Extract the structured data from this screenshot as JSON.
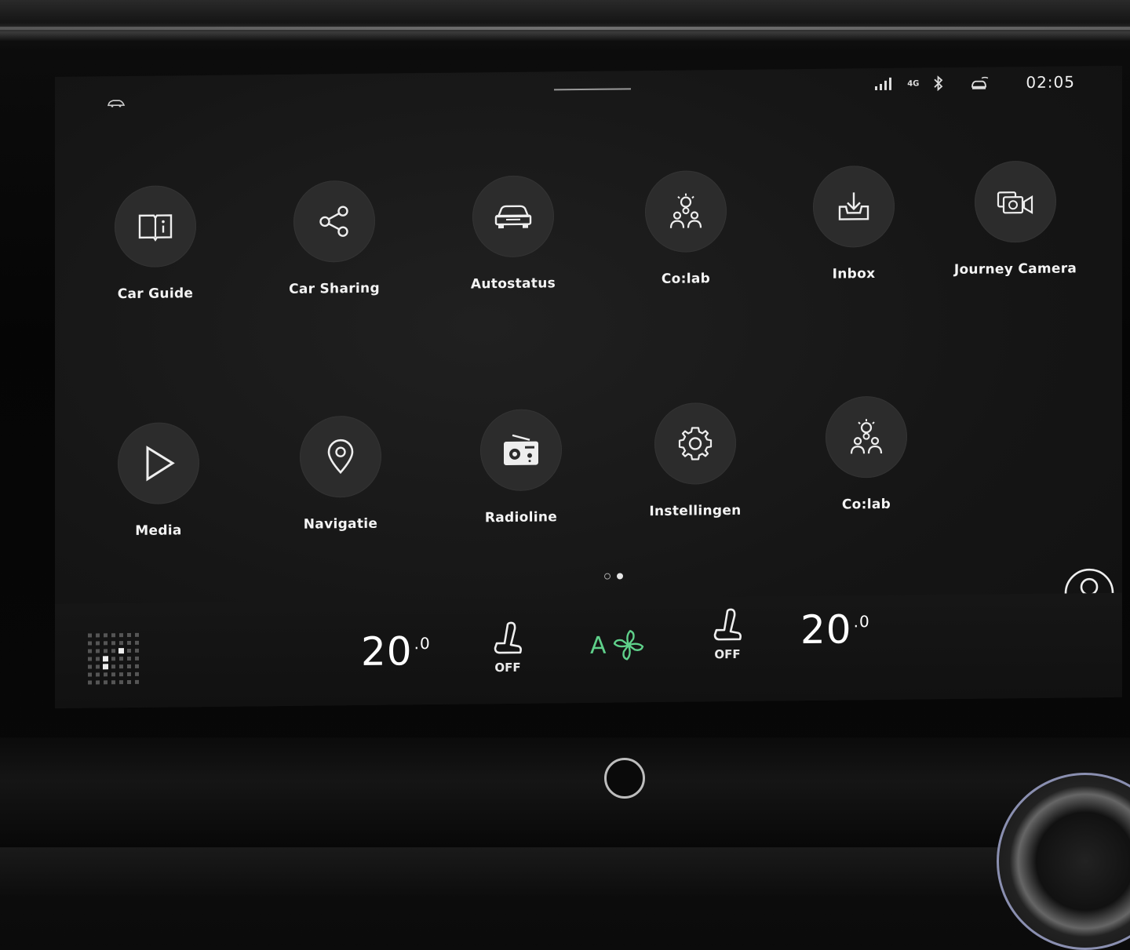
{
  "status": {
    "network": "4G",
    "time": "02:05"
  },
  "apps": [
    {
      "label": "Car Guide",
      "icon": "book-icon"
    },
    {
      "label": "Car Sharing",
      "icon": "share-icon"
    },
    {
      "label": "Autostatus",
      "icon": "car-front-icon"
    },
    {
      "label": "Co:lab",
      "icon": "colab-icon"
    },
    {
      "label": "Inbox",
      "icon": "inbox-download-icon"
    },
    {
      "label": "Journey Camera",
      "icon": "camera-icon"
    },
    {
      "label": "Media",
      "icon": "play-icon"
    },
    {
      "label": "Navigatie",
      "icon": "map-pin-icon"
    },
    {
      "label": "Radioline",
      "icon": "radio-icon"
    },
    {
      "label": "Instellingen",
      "icon": "gear-icon"
    },
    {
      "label": "Co:lab",
      "icon": "colab-icon"
    }
  ],
  "climate": {
    "driver_temp": "20",
    "driver_temp_decimal": ".0",
    "passenger_temp": "20",
    "passenger_temp_decimal": ".0",
    "driver_seat": "OFF",
    "passenger_seat": "OFF",
    "fan_mode": "A",
    "fan_color": "#5fd08a"
  },
  "pager": {
    "pages": 2,
    "active": 2
  }
}
